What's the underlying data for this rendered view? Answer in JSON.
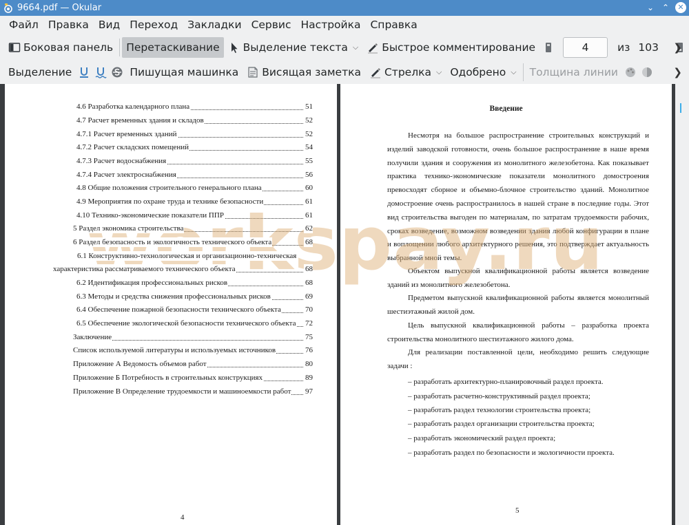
{
  "window": {
    "title": "9664.pdf  — Okular"
  },
  "menu": [
    "Файл",
    "Правка",
    "Вид",
    "Переход",
    "Закладки",
    "Сервис",
    "Настройка",
    "Справка"
  ],
  "toolbar1": {
    "sidebar": "Боковая панель",
    "drag": "Перетаскивание",
    "text_select": "Выделение текста",
    "quick_comment": "Быстрое комментирование",
    "page_current": "4",
    "of_label": "из",
    "page_total": "103"
  },
  "toolbar2": {
    "highlight": "Выделение",
    "typewriter": "Пишущая машинка",
    "popup_note": "Висящая заметка",
    "arrow": "Стрелка",
    "stamp": "Одобрено",
    "line_width": "Толщина линии"
  },
  "left_page": {
    "toc": [
      {
        "text": "4.6 Разработка календарного плана",
        "page": "51"
      },
      {
        "text": "4.7 Расчет временных здания и складов",
        "page": "52"
      },
      {
        "text": "4.7.1 Расчет временных зданий",
        "page": "52"
      },
      {
        "text": "4.7.2 Расчет складских помещений",
        "page": "54"
      },
      {
        "text": "4.7.3  Расчет водоснабжения",
        "page": "55"
      },
      {
        "text": "4.7.4  Расчет электроснабжения",
        "page": "56"
      },
      {
        "text": "4.8 Общие положения строительного генерального плана",
        "page": "60"
      },
      {
        "text": "4.9 Мероприятия по охране труда и технике безопасности",
        "page": "61"
      },
      {
        "text": "4.10 Технико-экономические показатели ППР",
        "page": "61"
      },
      {
        "text": "5 Раздел экономика строительства",
        "page": "62"
      },
      {
        "text": "6 Раздел безопасность и экологичность технического объекта",
        "page": "68"
      },
      {
        "text": "6.1 Конструктивно-технологическая и организационно-техническая",
        "page": ""
      },
      {
        "text": "характеристика рассматриваемого технического объекта",
        "page": "68"
      },
      {
        "text": "6.2 Идентификация профессиональных рисков",
        "page": "68"
      },
      {
        "text": "6.3 Методы и средства снижения профессиональных рисков",
        "page": "69"
      },
      {
        "text": "6.4 Обеспечение пожарной безопасности технического объекта",
        "page": "70"
      },
      {
        "text": "6.5 Обеспечение экологической безопасности технического объекта",
        "page": "72"
      },
      {
        "text": "Заключение",
        "page": "75"
      },
      {
        "text": "Список используемой литературы и используемых источников",
        "page": "76"
      },
      {
        "text": "Приложение А Ведомость объемов работ",
        "page": "80"
      },
      {
        "text": "Приложение Б Потребность в строительных конструкциях",
        "page": "89"
      },
      {
        "text": "Приложение В Определение трудоемкости и машиноемкости работ",
        "page": "97"
      }
    ],
    "page_number": "4"
  },
  "right_page": {
    "heading": "Введение",
    "paragraphs": [
      "Несмотря на большое распространение строительных конструкций и изделий заводской готовности, очень большое распространение в наше время получили здания и сооружения из монолитного железобетона. Как показывает практика технико-экономические показатели монолитного домостроения превосходят сборное и объемно-блочное строительство зданий. Монолитное домостроение очень распространилось в нашей стране в последние годы. Этот вид строительства выгоден по материалам, по затратам трудоемкости рабочих, сроках возведение, возможном возведении здания любой конфигурации в плане и воплощении любого архитектурного решения, это подтверждает актуальность выбранной мной темы.",
      "Объектом выпускной квалификационной работы является возведение зданий из монолитного железобетона.",
      "Предметом выпускной квалификационной работы является монолитный шестиэтажный жилой дом.",
      "Цель выпускной квалификационной работы – разработка проекта строительства монолитного шестиэтажного жилого дома.",
      "Для реализации поставленной цели, необходимо решить следующие задачи :"
    ],
    "tasks": [
      "–  разработать архитектурно-планировочный раздел проекта.",
      "–  разработать расчетно-конструктивный раздел проекта;",
      "–  разработать раздел технологии строительства проекта;",
      "–  разработать раздел организации строительства проекта;",
      "–  разработать экономический раздел проекта;",
      "–  разработать раздел по безопасности и экологичности проекта."
    ],
    "page_number": "5"
  },
  "watermark": "workspay.ru",
  "colors": {
    "titlebar": "#4d8bc8",
    "accent": "#3daee9",
    "chrome": "#eff0f1"
  }
}
